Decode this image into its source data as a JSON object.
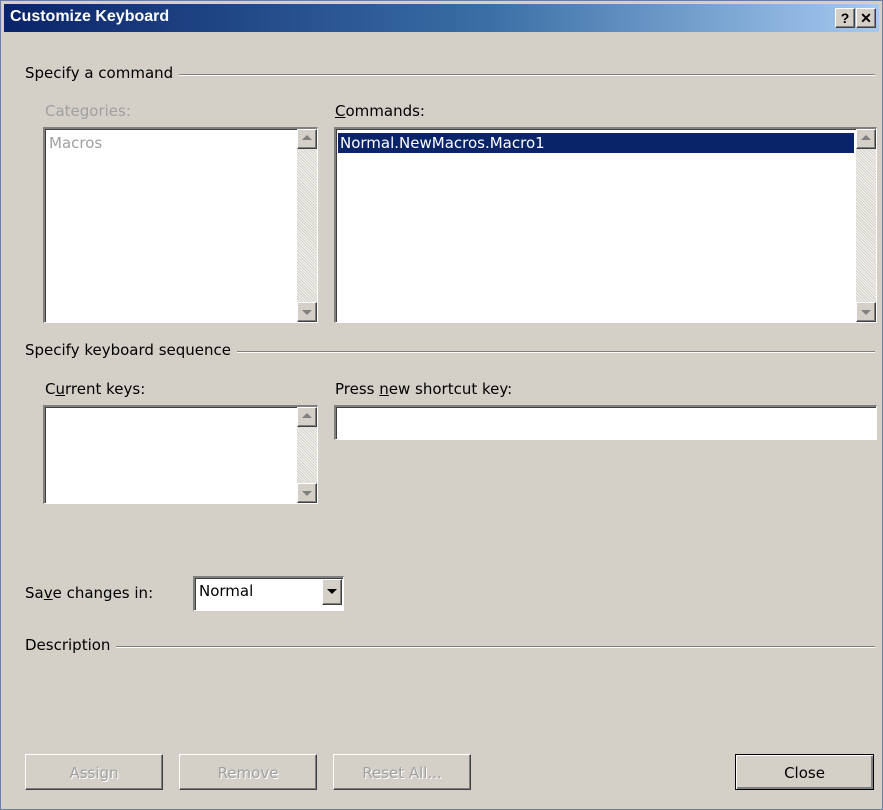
{
  "window": {
    "title": "Customize Keyboard",
    "help_button": "?",
    "close_button": "✕"
  },
  "command_group": {
    "title": "Specify a command",
    "categories_label": "Categories:",
    "categories": [
      "Macros"
    ],
    "commands_label": "Commands:",
    "commands": [
      "Normal.NewMacros.Macro1"
    ]
  },
  "keyboard_group": {
    "title": "Specify keyboard sequence",
    "current_keys_label": "Current keys:",
    "new_key_label": "Press new shortcut key:",
    "new_key_value": ""
  },
  "save_changes": {
    "label": "Save changes in:",
    "value": "Normal"
  },
  "description": {
    "title": "Description"
  },
  "buttons": {
    "assign": "Assign",
    "remove": "Remove",
    "reset_all": "Reset All...",
    "close": "Close"
  },
  "colors": {
    "dialog_bg": "#d4d0c8",
    "titlebar_start": "#0a246a",
    "titlebar_end": "#a6caf0",
    "selection": "#0a246a"
  }
}
